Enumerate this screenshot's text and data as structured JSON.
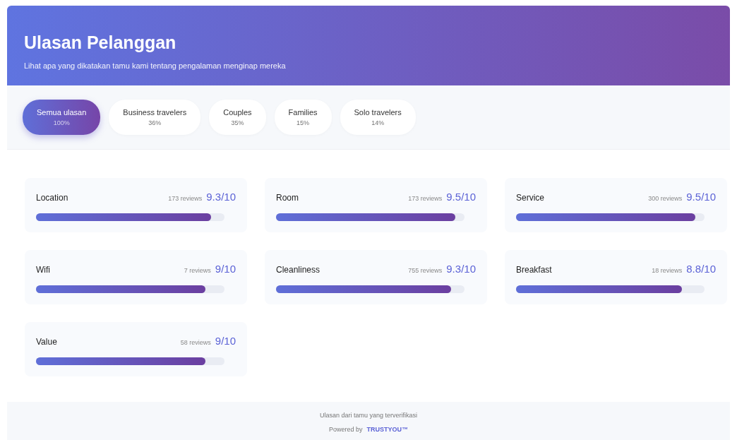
{
  "header": {
    "title": "Ulasan Pelanggan",
    "subtitle": "Lihat apa yang dikatakan tamu kami tentang pengalaman menginap mereka"
  },
  "tabs": [
    {
      "label": "Semua ulasan",
      "share": "100%",
      "selected": true
    },
    {
      "label": "Business travelers",
      "share": "36%",
      "selected": false
    },
    {
      "label": "Couples",
      "share": "35%",
      "selected": false
    },
    {
      "label": "Families",
      "share": "15%",
      "selected": false
    },
    {
      "label": "Solo travelers",
      "share": "14%",
      "selected": false
    }
  ],
  "categories": [
    {
      "name": "Location",
      "count": "173 reviews",
      "score": "9.3/10",
      "level": 0.93
    },
    {
      "name": "Room",
      "count": "173 reviews",
      "score": "9.5/10",
      "level": 0.95
    },
    {
      "name": "Service",
      "count": "300 reviews",
      "score": "9.5/10",
      "level": 0.95
    },
    {
      "name": "Wifi",
      "count": "7 reviews",
      "score": "9/10",
      "level": 0.9
    },
    {
      "name": "Cleanliness",
      "count": "755 reviews",
      "score": "9.3/10",
      "level": 0.93
    },
    {
      "name": "Breakfast",
      "count": "18 reviews",
      "score": "8.8/10",
      "level": 0.88
    },
    {
      "name": "Value",
      "count": "58 reviews",
      "score": "9/10",
      "level": 0.9
    }
  ],
  "footer": {
    "note": "Ulasan dari tamu yang terverifikasi",
    "powered_by": "Powered by",
    "brand": "TRUSTYOU™"
  }
}
